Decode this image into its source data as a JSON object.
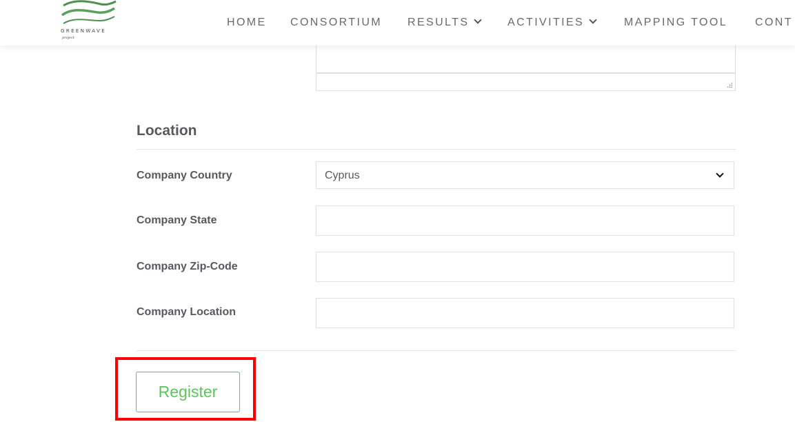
{
  "brand": {
    "name": "GREENWAVE",
    "tagline": "project",
    "accent": "#5a9e5a"
  },
  "nav": {
    "items": [
      {
        "label": "HOME",
        "has_dropdown": false
      },
      {
        "label": "CONSORTIUM",
        "has_dropdown": false
      },
      {
        "label": "RESULTS",
        "has_dropdown": true
      },
      {
        "label": "ACTIVITIES",
        "has_dropdown": true
      },
      {
        "label": "MAPPING TOOL",
        "has_dropdown": false
      },
      {
        "label": "CONT",
        "has_dropdown": false
      }
    ]
  },
  "form": {
    "section_title": "Location",
    "fields": [
      {
        "label": "Company Country",
        "type": "select",
        "value": "Cyprus"
      },
      {
        "label": "Company State",
        "type": "text",
        "value": ""
      },
      {
        "label": "Company Zip-Code",
        "type": "text",
        "value": ""
      },
      {
        "label": "Company Location",
        "type": "text",
        "value": ""
      }
    ],
    "submit_label": "Register"
  },
  "colors": {
    "button_green": "#5cc45c",
    "highlight_red": "#ff0000",
    "label_gray": "#555a5e"
  }
}
